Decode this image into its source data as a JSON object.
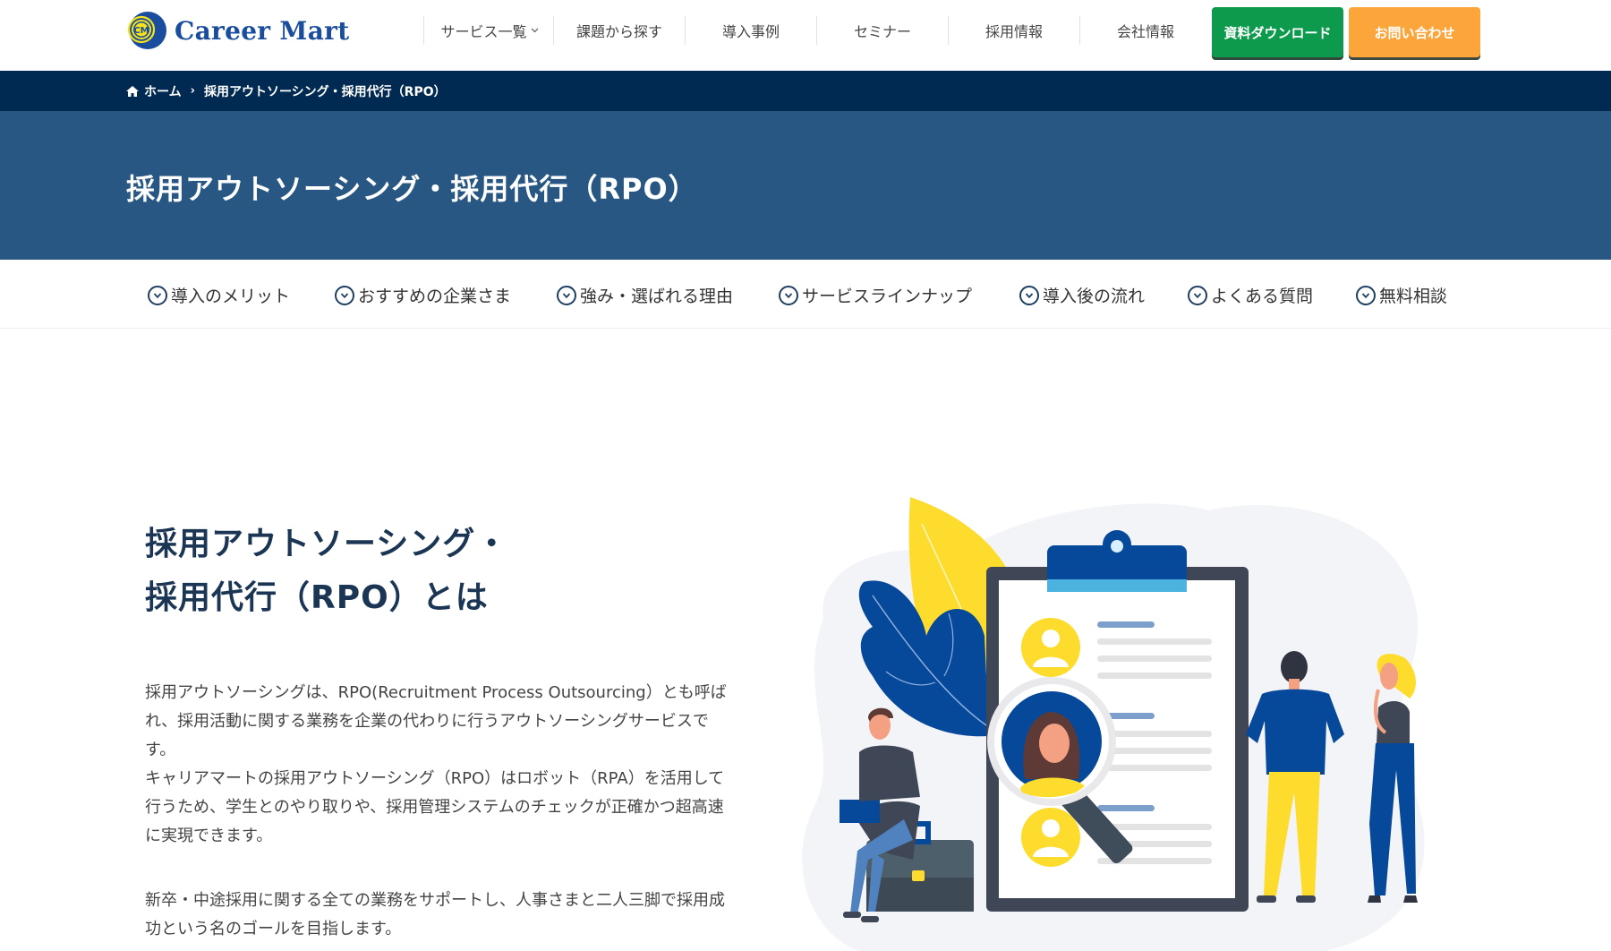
{
  "header": {
    "logo_text": "Career Mart",
    "logo_mark": "CM",
    "nav": [
      {
        "label": "サービス一覧",
        "has_dropdown": true
      },
      {
        "label": "課題から探す"
      },
      {
        "label": "導入事例"
      },
      {
        "label": "セミナー"
      },
      {
        "label": "採用情報"
      },
      {
        "label": "会社情報"
      }
    ],
    "download_button": "資料ダウンロード",
    "contact_button": "お問い合わせ",
    "colors": {
      "download": "#0e9a4d",
      "contact": "#fca53b",
      "brand": "#1a4d9e"
    }
  },
  "breadcrumb": {
    "home_icon": "home-icon",
    "home": "ホーム",
    "separator": "›",
    "current": "採用アウトソーシング・採用代行（RPO）"
  },
  "banner": {
    "title": "採用アウトソーシング・採用代行（RPO）"
  },
  "anchor_nav": [
    {
      "label": "導入のメリット",
      "icon": "chevron-circle-down-icon"
    },
    {
      "label": "おすすめの企業さま",
      "icon": "chevron-circle-down-icon"
    },
    {
      "label": "強み・選ばれる理由",
      "icon": "chevron-circle-down-icon"
    },
    {
      "label": "サービスラインナップ",
      "icon": "chevron-circle-down-icon"
    },
    {
      "label": "導入後の流れ",
      "icon": "chevron-circle-down-icon"
    },
    {
      "label": "よくある質問",
      "icon": "chevron-circle-down-icon"
    },
    {
      "label": "無料相談",
      "icon": "chevron-circle-down-icon"
    }
  ],
  "main": {
    "title_line1": "採用アウトソーシング・",
    "title_line2": "採用代行（RPO）とは",
    "paragraph1": "採用アウトソーシングは、RPO(Recruitment Process Outsourcing）とも呼ばれ、採用活動に関する業務を企業の代わりに行うアウトソーシングサービスです。\nキャリアマートの採用アウトソーシング（RPO）はロボット（RPA）を活用して行うため、学生とのやり取りや、採用管理システムのチェックが正確かつ超高速に実現できます。",
    "paragraph2": "新卒・中途採用に関する全ての業務をサポートし、人事さまと二人三脚で採用成功という名のゴールを目指します。"
  },
  "illustration": {
    "description": "recruitment-clipboard-illustration"
  }
}
